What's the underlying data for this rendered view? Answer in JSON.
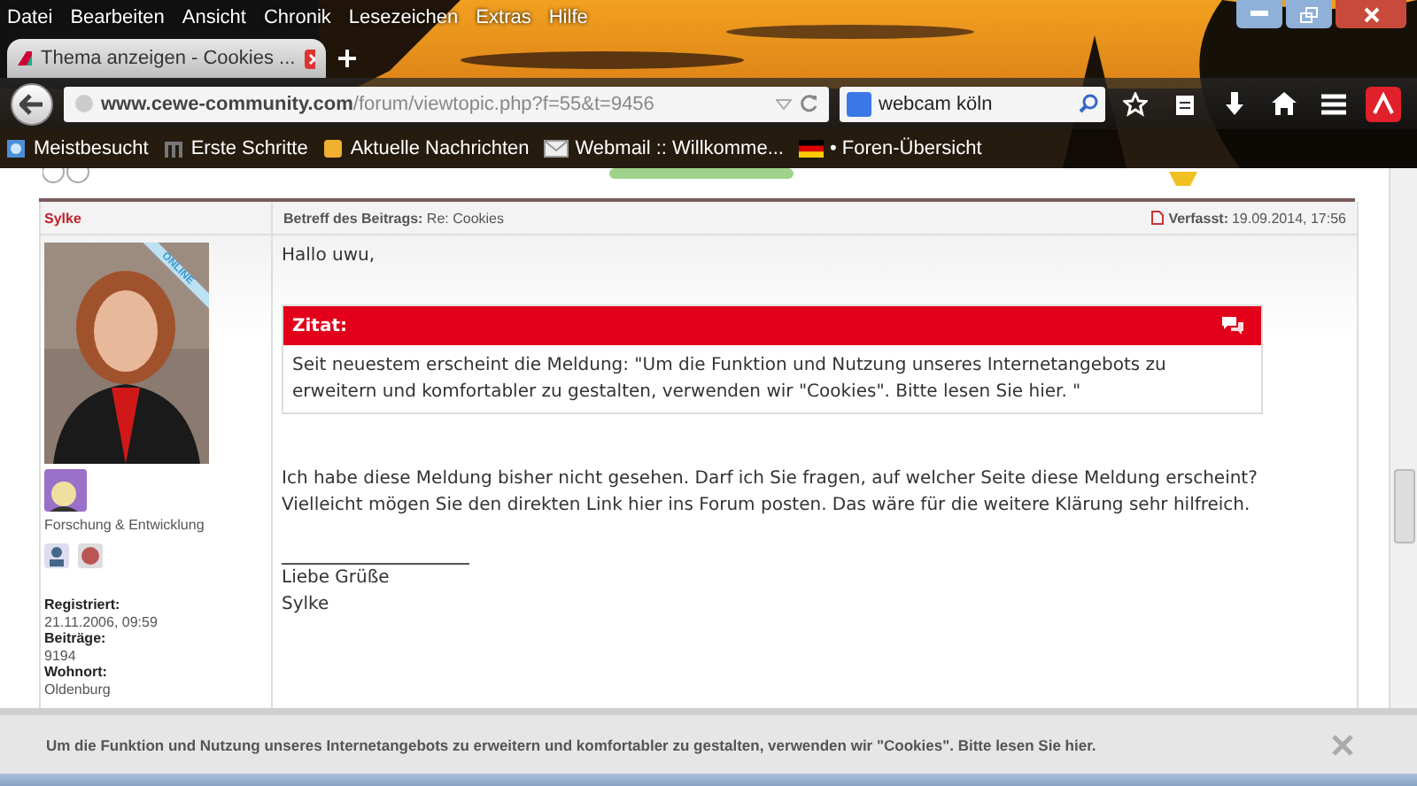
{
  "menu": [
    "Datei",
    "Bearbeiten",
    "Ansicht",
    "Chronik",
    "Lesezeichen",
    "Extras",
    "Hilfe"
  ],
  "tabs": [
    {
      "title": "Thema anzeigen - Cookies ...",
      "selected": true
    }
  ],
  "address": {
    "host": "www.cewe-community.com",
    "path": "/forum/viewtopic.php?f=55&t=9456"
  },
  "search": {
    "value": "webcam köln"
  },
  "bookmarks": [
    {
      "label": "Meistbesucht",
      "kind": "star"
    },
    {
      "label": "Erste Schritte",
      "kind": "m"
    },
    {
      "label": "Aktuelle Nachrichten",
      "kind": "feed"
    },
    {
      "label": "Webmail :: Willkomme...",
      "kind": "mail"
    },
    {
      "label": "• Foren-Übersicht",
      "kind": "flag"
    }
  ],
  "post": {
    "author": "Sylke",
    "subject_label": "Betreff des Beitrags:",
    "subject": "Re: Cookies",
    "posted_label": "Verfasst:",
    "posted": "19.09.2014, 17:56",
    "online_badge": "ONLINE",
    "rank": "Forschung & Entwicklung",
    "profile": [
      {
        "label": "Registriert:",
        "value": "21.11.2006, 09:59"
      },
      {
        "label": "Beiträge:",
        "value": "9194"
      },
      {
        "label": "Wohnort:",
        "value": "Oldenburg"
      }
    ],
    "greeting": "Hallo uwu,",
    "quote": {
      "title": "Zitat:",
      "text": "Seit neuestem erscheint die Meldung: \"Um die Funktion und Nutzung unseres Internetangebots zu erweitern und komfortabler zu gestalten, verwenden wir \"Cookies\". Bitte lesen Sie hier. \""
    },
    "paragraph": "Ich habe diese Meldung bisher nicht gesehen. Darf ich Sie fragen, auf welcher Seite diese Meldung erscheint? Vielleicht mögen Sie den direkten Link hier ins Forum posten. Das wäre für die weitere Klärung sehr hilfreich.",
    "signature": [
      "Liebe Grüße",
      "Sylke"
    ]
  },
  "cookie_notice": {
    "text": "Um die Funktion und Nutzung unseres Internetangebots zu erweitern und komfortabler zu gestalten, verwenden wir \"Cookies\". Bitte lesen Sie hier."
  }
}
